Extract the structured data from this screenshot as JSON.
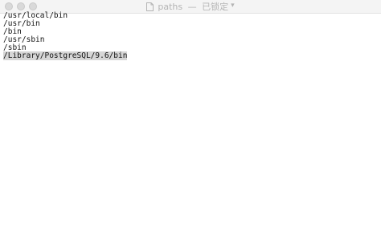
{
  "window": {
    "title": "paths",
    "separator": "—",
    "status": "已锁定",
    "chevron_icon": "chevron-down-icon",
    "doc_icon": "document-icon"
  },
  "editor": {
    "lines": [
      "/usr/local/bin",
      "/usr/bin",
      "/bin",
      "/usr/sbin",
      "/sbin",
      "/Library/PostgreSQL/9.6/bin"
    ],
    "selected_line_index": 5
  }
}
